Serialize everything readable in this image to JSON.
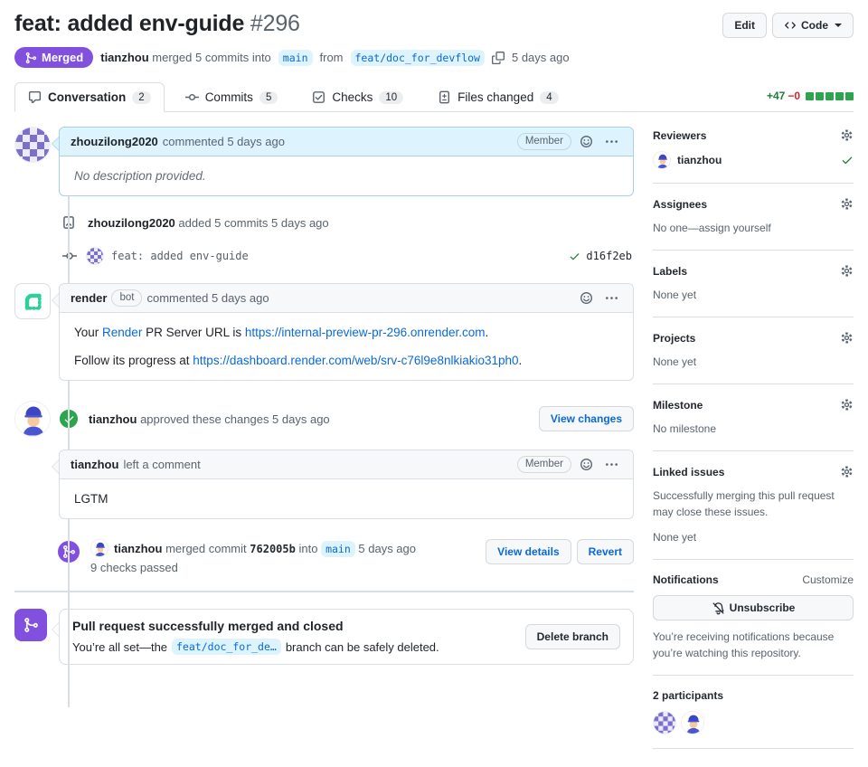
{
  "header": {
    "title": "feat: added env-guide",
    "number": "#296",
    "edit_label": "Edit",
    "code_label": "Code"
  },
  "meta": {
    "status_label": "Merged",
    "author": "tianzhou",
    "action": "merged 5 commits into",
    "base_branch": "main",
    "from_word": "from",
    "head_branch": "feat/doc_for_devflow",
    "time": "5 days ago"
  },
  "tabs": [
    {
      "label": "Conversation",
      "count": "2"
    },
    {
      "label": "Commits",
      "count": "5"
    },
    {
      "label": "Checks",
      "count": "10"
    },
    {
      "label": "Files changed",
      "count": "4"
    }
  ],
  "diffstat": {
    "additions": "+47",
    "deletions": "−0"
  },
  "timeline": {
    "comment1": {
      "author": "zhouzilong2020",
      "action": "commented 5 days ago",
      "badge": "Member",
      "body": "No description provided."
    },
    "commits_event": {
      "author": "zhouzilong2020",
      "action": "added 5 commits 5 days ago"
    },
    "commit": {
      "message": "feat: added env-guide",
      "sha": "d16f2eb"
    },
    "bot_comment": {
      "author": "render",
      "badge": "bot",
      "action": "commented 5 days ago",
      "p1_t1": "Your ",
      "p1_link1": "Render",
      "p1_t2": " PR Server URL is ",
      "p1_link2": "https://internal-preview-pr-296.onrender.com",
      "p1_t3": ".",
      "p2_t1": "Follow its progress at ",
      "p2_link": "https://dashboard.render.com/web/srv-c76l9e8nlkiakio31ph0",
      "p2_t2": "."
    },
    "review": {
      "author": "tianzhou",
      "action": "approved these changes 5 days ago",
      "view_changes": "View changes",
      "comment_author": "tianzhou",
      "comment_action": "left a comment",
      "badge": "Member",
      "body": "LGTM"
    },
    "merge_event": {
      "author": "tianzhou",
      "action": "merged commit",
      "sha": "762005b",
      "into_word": "into",
      "branch": "main",
      "time": "5 days ago",
      "checks": "9 checks passed",
      "view_details": "View details",
      "revert": "Revert"
    },
    "merged_box": {
      "title": "Pull request successfully merged and closed",
      "body_prefix": "You’re all set—the",
      "branch": "feat/doc_for_de…",
      "body_suffix": "branch can be safely deleted.",
      "button": "Delete branch"
    }
  },
  "sidebar": {
    "reviewers": {
      "title": "Reviewers",
      "name": "tianzhou"
    },
    "assignees": {
      "title": "Assignees",
      "empty": "No one—assign yourself"
    },
    "labels": {
      "title": "Labels",
      "empty": "None yet"
    },
    "projects": {
      "title": "Projects",
      "empty": "None yet"
    },
    "milestone": {
      "title": "Milestone",
      "empty": "No milestone"
    },
    "linked_issues": {
      "title": "Linked issues",
      "desc": "Successfully merging this pull request may close these issues.",
      "empty": "None yet"
    },
    "notifications": {
      "title": "Notifications",
      "customize": "Customize",
      "button": "Unsubscribe",
      "desc": "You’re receiving notifications because you’re watching this repository."
    },
    "participants": {
      "title": "2 participants"
    }
  },
  "colors": {
    "merged_purple": "#8250df",
    "success_green": "#2da44e",
    "link_blue": "#0969da"
  }
}
